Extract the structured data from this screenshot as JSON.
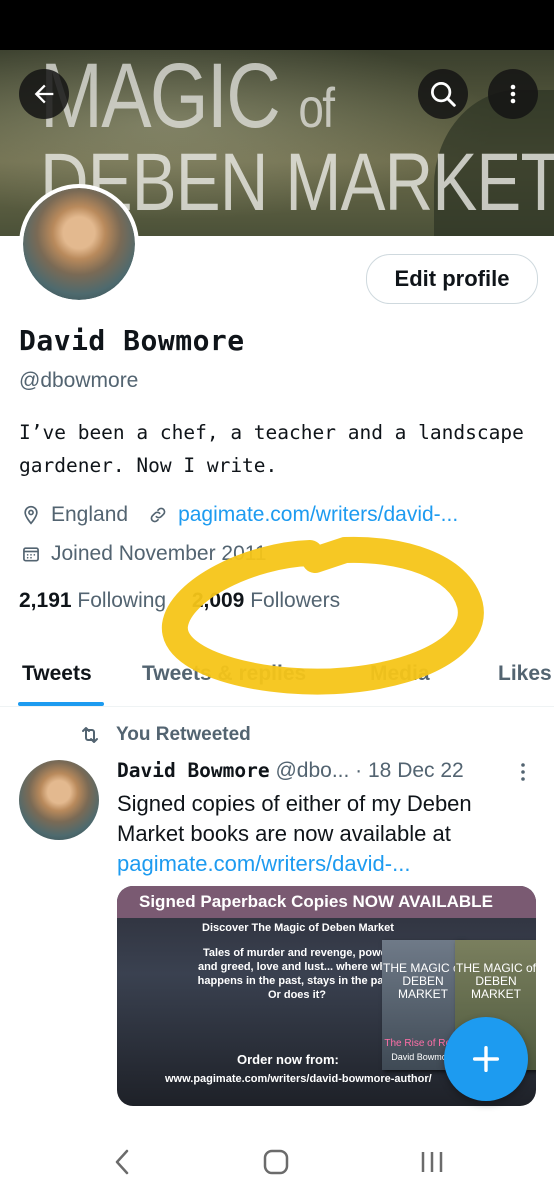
{
  "banner": {
    "line1": "MAGIC",
    "line1_small": "of",
    "line2": "DEBEN MARKET"
  },
  "profile": {
    "edit_label": "Edit profile",
    "name": "David Bowmore",
    "handle": "@dbowmore",
    "bio": "I’ve been a chef, a teacher and a landscape gardener. Now I write.",
    "location": "England",
    "website": "pagimate.com/writers/david-...",
    "joined": "Joined November 2011",
    "following_count": "2,191",
    "following_label": "Following",
    "followers_count": "2,009",
    "followers_label": "Followers"
  },
  "tabs": [
    "Tweets",
    "Tweets & replies",
    "Media",
    "Likes"
  ],
  "tweet": {
    "retweet_label": "You Retweeted",
    "author": "David Bowmore",
    "handle": "@dbo...",
    "date": "· 18 Dec 22",
    "text": "Signed copies of either of my Deben Market books are now available at",
    "link": "pagimate.com/writers/david-...",
    "media": {
      "header": "Signed Paperback Copies NOW AVAILABLE",
      "subheader": "Discover The Magic of Deben Market",
      "body": "Tales of murder and revenge, power and greed, love and lust... where what happens in the past, stays in the past. Or does it?",
      "order": "Order now from:",
      "url": "www.pagimate.com/writers/david-bowmore-author/",
      "book1_title": "THE MAGIC of DEBEN MARKET",
      "book1_sub": "The Rise of Rose",
      "book1_author": "David Bowmore",
      "book2_title": "THE MAGIC of DEBEN MARKET"
    }
  },
  "colors": {
    "accent": "#1d9bf0",
    "annotation": "#f5c518"
  }
}
